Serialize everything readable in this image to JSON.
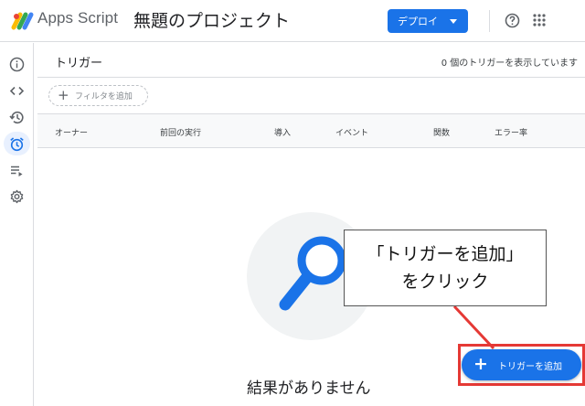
{
  "header": {
    "app_name": "Apps Script",
    "project_title": "無題のプロジェクト",
    "deploy_label": "デプロイ",
    "help_icon": "help-circle-icon",
    "apps_icon": "apps-grid-icon"
  },
  "rail": {
    "items": [
      {
        "icon": "info-icon",
        "active": false
      },
      {
        "icon": "code-icon",
        "active": false
      },
      {
        "icon": "history-icon",
        "active": false
      },
      {
        "icon": "alarm-clock-icon",
        "active": true
      },
      {
        "icon": "playlist-play-icon",
        "active": false
      },
      {
        "icon": "gear-icon",
        "active": false
      }
    ]
  },
  "main": {
    "title": "トリガー",
    "count_text": "0 個のトリガーを表示しています",
    "filter_label": "フィルタを追加",
    "columns": [
      "オーナー",
      "前回の実行",
      "導入",
      "イベント",
      "関数",
      "エラー率"
    ],
    "empty_text": "結果がありません",
    "add_button_label": "トリガーを追加"
  },
  "annotation": {
    "line1": "「トリガーを追加」",
    "line2": "をクリック",
    "highlight_color": "#e53935"
  },
  "colors": {
    "accent": "#1a73e8",
    "active_bg": "#e8f0fe",
    "magnifier": "#1a73e8"
  }
}
